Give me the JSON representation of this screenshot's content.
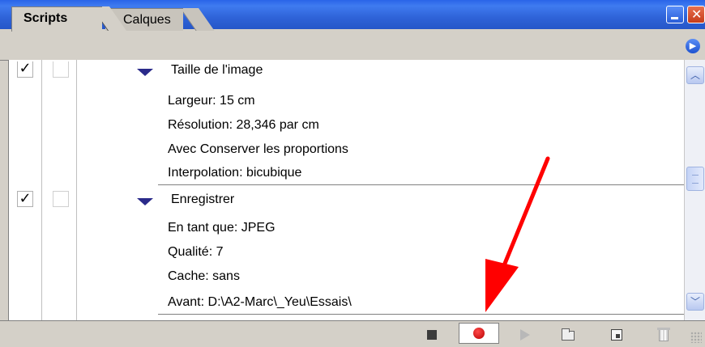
{
  "tabs": [
    {
      "label": "Scripts",
      "active": true
    },
    {
      "label": "Calques",
      "active": false
    }
  ],
  "actions": [
    {
      "checked": true,
      "title": "Taille de l'image",
      "params": [
        "Largeur: 15 cm",
        "Résolution: 28,346 par cm",
        "Avec Conserver les proportions",
        "Interpolation: bicubique"
      ]
    },
    {
      "checked": true,
      "title": "Enregistrer",
      "params": [
        "En tant que: JPEG",
        "Qualité: 7",
        "Cache: sans",
        "Avant: D:\\A2-Marc\\_Yeu\\Essais\\"
      ]
    }
  ],
  "toolbar": {
    "icons": [
      "stop-icon",
      "record-icon",
      "play-icon",
      "folder-icon",
      "new-script-icon",
      "trash-icon"
    ],
    "record_color": "#d00000"
  },
  "annotation": {
    "color": "#ff0000",
    "points_to": "record-button"
  }
}
